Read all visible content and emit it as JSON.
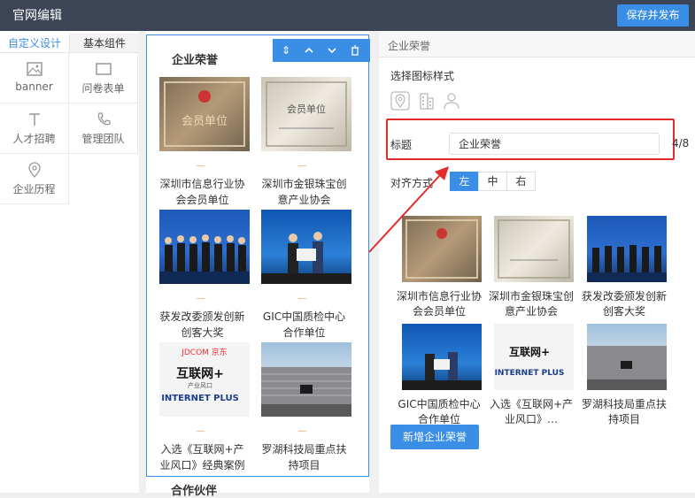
{
  "header": {
    "title": "官网编辑",
    "publish_label": "保存并发布"
  },
  "left_panel": {
    "tabs": [
      "自定义设计",
      "基本组件"
    ],
    "components": [
      "banner",
      "问卷表单",
      "人才招聘",
      "管理团队",
      "企业历程"
    ]
  },
  "preview": {
    "section_title": "企业荣誉",
    "next_section_title": "合作伙伴",
    "dash": "—",
    "cards": [
      {
        "caption": "深圳市信息行业协会会员单位"
      },
      {
        "caption": "深圳市金银珠宝创意产业协会"
      },
      {
        "caption": "获发改委颁发创新创客大奖"
      },
      {
        "caption": "GIC中国质检中心合作单位"
      },
      {
        "caption": "入选《互联网+产业风口》经典案例"
      },
      {
        "caption": "罗湖科技局重点扶持项目"
      }
    ],
    "image_text": {
      "plaque1": "会员单位",
      "plaque2": "会员单位",
      "plus_brand": "JDCOM 京东",
      "plus_title": "互联网+",
      "plus_sub": "产业风口",
      "plus_en": "INTERNET PLUS"
    }
  },
  "settings": {
    "panel_title": "企业荣誉",
    "icon_style_label": "选择图标样式",
    "title_label": "标题",
    "title_value": "企业荣誉",
    "char_count": "4/8",
    "align_label": "对齐方式",
    "align_options": [
      "左",
      "中",
      "右"
    ],
    "align_selected": "左",
    "thumbs": [
      {
        "caption": "深圳市信息行业协会会员单位"
      },
      {
        "caption": "深圳市金银珠宝创意产业协会"
      },
      {
        "caption": "获发改委颁发创新创客大奖"
      },
      {
        "caption": "GIC中国质检中心合作单位"
      },
      {
        "caption": "入选《互联网+产业风口》…"
      },
      {
        "caption": "罗湖科技局重点扶持项目"
      }
    ],
    "add_button_label": "新增企业荣誉"
  },
  "colors": {
    "accent": "#3a8ee6",
    "topbar": "#3b4556",
    "highlight": "#e22c2c"
  },
  "icons": [
    "image-icon",
    "form-icon",
    "recruit-icon",
    "phone-icon",
    "location-icon",
    "sort-icon",
    "chevron-up-icon",
    "chevron-down-icon",
    "trash-icon",
    "pin-icon",
    "building-icon",
    "person-icon"
  ]
}
